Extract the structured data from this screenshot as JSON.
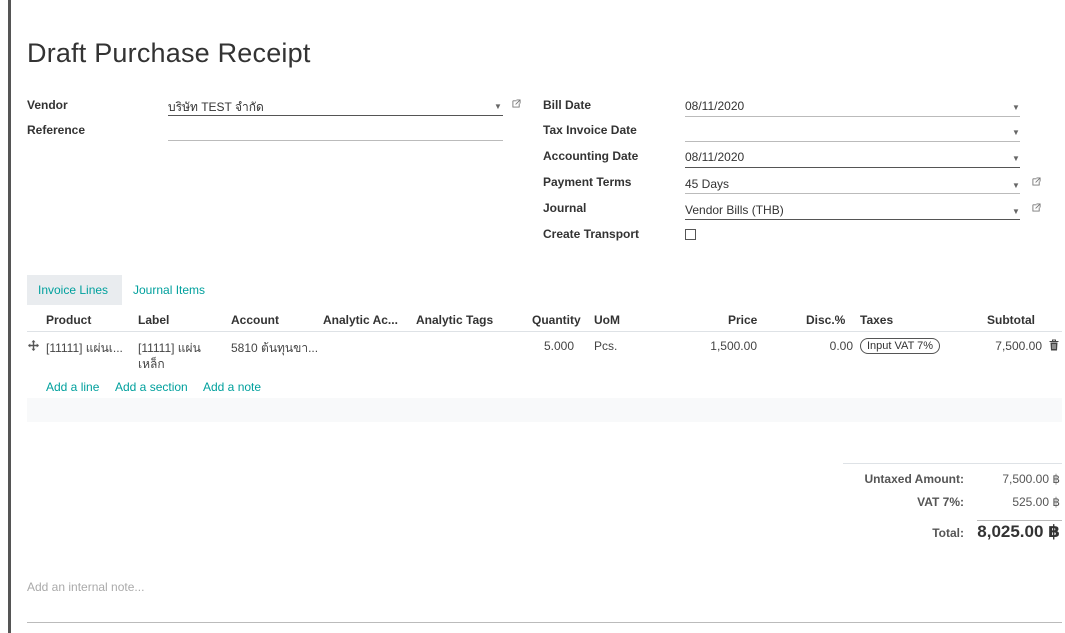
{
  "title": "Draft Purchase Receipt",
  "left_fields": {
    "vendor_label": "Vendor",
    "vendor_value": "บริษัท TEST จำกัด",
    "reference_label": "Reference",
    "reference_value": ""
  },
  "right_fields": {
    "bill_date_label": "Bill Date",
    "bill_date_value": "08/11/2020",
    "tax_invoice_date_label": "Tax Invoice Date",
    "tax_invoice_date_value": "",
    "accounting_date_label": "Accounting Date",
    "accounting_date_value": "08/11/2020",
    "payment_terms_label": "Payment Terms",
    "payment_terms_value": "45 Days",
    "journal_label": "Journal",
    "journal_value": "Vendor Bills (THB)",
    "create_transport_label": "Create Transport",
    "create_transport_checked": false
  },
  "tabs": [
    "Invoice Lines",
    "Journal Items"
  ],
  "columns": [
    "Product",
    "Label",
    "Account",
    "Analytic Ac...",
    "Analytic Tags",
    "Quantity",
    "UoM",
    "Price",
    "Disc.%",
    "Taxes",
    "Subtotal"
  ],
  "line": {
    "product": "[11111] แผ่นเ...",
    "label_1": "[11111] แผ่น",
    "label_2": "เหล็ก",
    "account": "5810 ต้นทุนขา...",
    "quantity": "5.000",
    "uom": "Pcs.",
    "price": "1,500.00",
    "discount": "0.00",
    "tax": "Input VAT 7%",
    "subtotal": "7,500.00"
  },
  "actions": [
    "Add a line",
    "Add a section",
    "Add a note"
  ],
  "totals": {
    "untaxed_label": "Untaxed Amount:",
    "untaxed_value": "7,500.00 ฿",
    "vat_label": "VAT 7%:",
    "vat_value": "525.00 ฿",
    "total_label": "Total:",
    "total_value": "8,025.00 ฿"
  },
  "internal_note_placeholder": "Add an internal note...",
  "colors": {
    "accent": "#00a09d",
    "tab_bg": "#e9ecef"
  }
}
